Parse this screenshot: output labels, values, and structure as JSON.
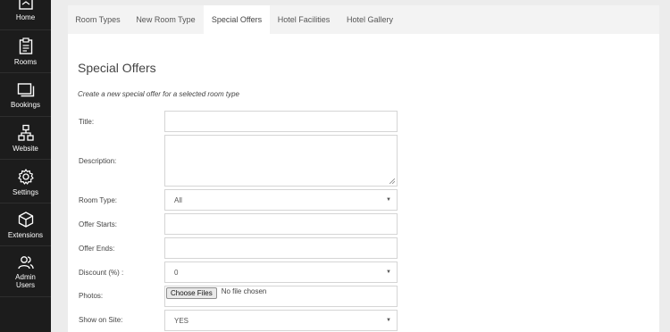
{
  "sidebar": {
    "items": [
      {
        "label": "Home",
        "icon": "home-icon"
      },
      {
        "label": "Rooms",
        "icon": "clipboard-icon"
      },
      {
        "label": "Bookings",
        "icon": "stacked-windows-icon"
      },
      {
        "label": "Website",
        "icon": "sitemap-icon"
      },
      {
        "label": "Settings",
        "icon": "gear-icon"
      },
      {
        "label": "Extensions",
        "icon": "cube-icon"
      },
      {
        "label": "Admin Users",
        "icon": "users-icon"
      }
    ]
  },
  "tabs": [
    "Room Types",
    "New Room Type",
    "Special Offers",
    "Hotel Facilities",
    "Hotel Gallery"
  ],
  "active_tab": "Special Offers",
  "page": {
    "title": "Special Offers",
    "subtitle": "Create a new special offer for a selected room type"
  },
  "form": {
    "title_label": "Title:",
    "description_label": "Description:",
    "room_type_label": "Room Type:",
    "room_type_value": "All",
    "offer_starts_label": "Offer Starts:",
    "offer_ends_label": "Offer Ends:",
    "discount_label": "Discount (%) :",
    "discount_value": "0",
    "photos_label": "Photos:",
    "choose_files": "Choose Files",
    "no_file": "No file chosen",
    "show_on_site_label": "Show on Site:",
    "show_on_site_value": "YES"
  },
  "colors": {
    "sidebar_bg": "#1c1c1c",
    "page_bg": "#ececec",
    "tabbar_bg": "#f3f3f3",
    "panel_bg": "#ffffff"
  }
}
